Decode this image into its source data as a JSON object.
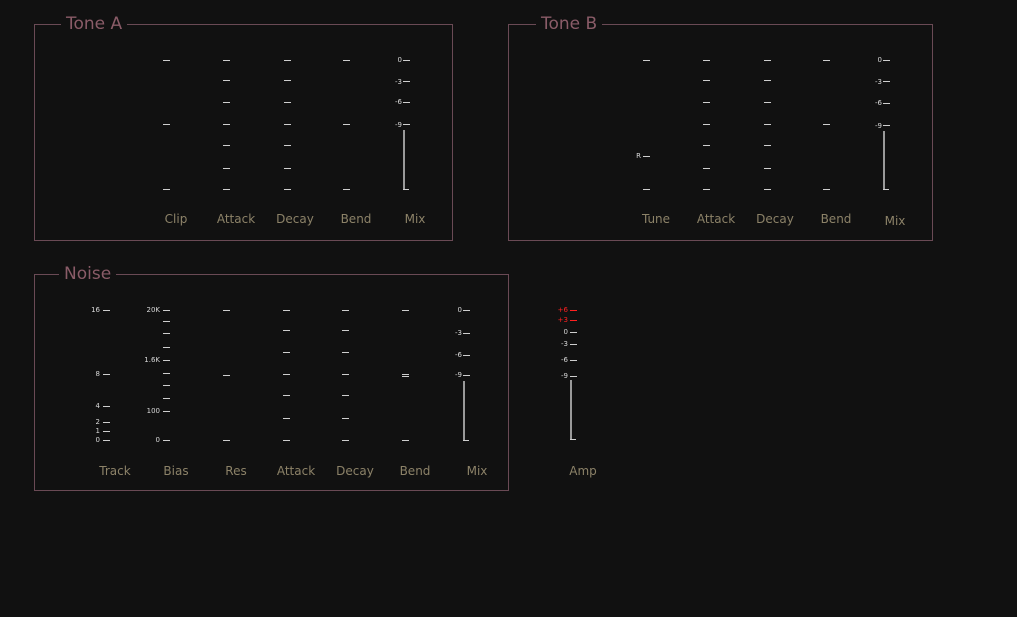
{
  "colors": {
    "background": "#111111",
    "frame": "#6a4a55",
    "title": "#8a5c68",
    "label": "#8c8268",
    "tick": "#cfcfcf",
    "hot_tick": "#ff2020"
  },
  "tone_a": {
    "title": "Tone A",
    "controls": [
      {
        "label": "Clip"
      },
      {
        "label": "Attack"
      },
      {
        "label": "Decay"
      },
      {
        "label": "Bend"
      },
      {
        "label": "Mix",
        "scale": [
          "0",
          "-3",
          "-6",
          "-9"
        ]
      }
    ]
  },
  "tone_b": {
    "title": "Tone B",
    "controls": [
      {
        "label": "Tune",
        "marker": "R"
      },
      {
        "label": "Attack"
      },
      {
        "label": "Decay"
      },
      {
        "label": "Bend"
      },
      {
        "label": "Mix",
        "scale": [
          "0",
          "-3",
          "-6",
          "-9"
        ]
      }
    ]
  },
  "noise": {
    "title": "Noise",
    "controls": [
      {
        "label": "Track",
        "scale": [
          "16",
          "8",
          "4",
          "2",
          "1",
          "0"
        ]
      },
      {
        "label": "Bias",
        "scale": [
          "20K",
          "1.6K",
          "100",
          "0"
        ]
      },
      {
        "label": "Res"
      },
      {
        "label": "Attack"
      },
      {
        "label": "Decay"
      },
      {
        "label": "Bend"
      },
      {
        "label": "Mix",
        "scale": [
          "0",
          "-3",
          "-6",
          "-9"
        ]
      }
    ]
  },
  "amp": {
    "label": "Amp",
    "scale": [
      "+6",
      "+3",
      "0",
      "-3",
      "-6",
      "-9"
    ]
  }
}
